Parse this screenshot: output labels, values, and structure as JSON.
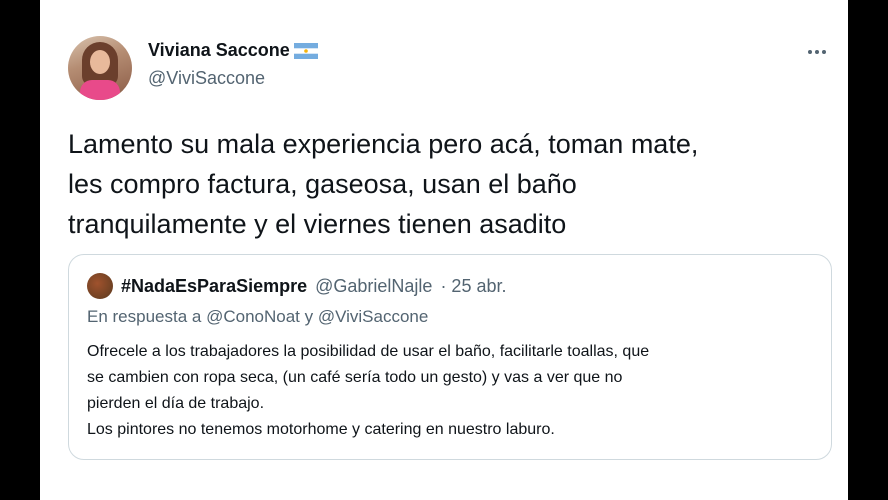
{
  "tweet": {
    "author_name": "Viviana Saccone",
    "author_handle": "@ViviSaccone",
    "lines": [
      "Lamento su mala experiencia pero acá, toman mate,",
      "les compro factura, gaseosa, usan el baño",
      "tranquilamente y el viernes tienen asadito"
    ]
  },
  "quote": {
    "author_name": "#NadaEsParaSiempre",
    "author_handle": "@GabrielNajle",
    "date": "· 25 abr.",
    "reply_to": "En respuesta a @ConoNoat y @ViviSaccone",
    "lines": [
      "Ofrecele a los trabajadores la posibilidad de usar el baño, facilitarle toallas, que",
      "se cambien con ropa seca, (un café sería todo un gesto) y vas a ver que no",
      "pierden el día de trabajo.",
      "Los pintores no tenemos motorhome y catering en nuestro laburo."
    ]
  }
}
